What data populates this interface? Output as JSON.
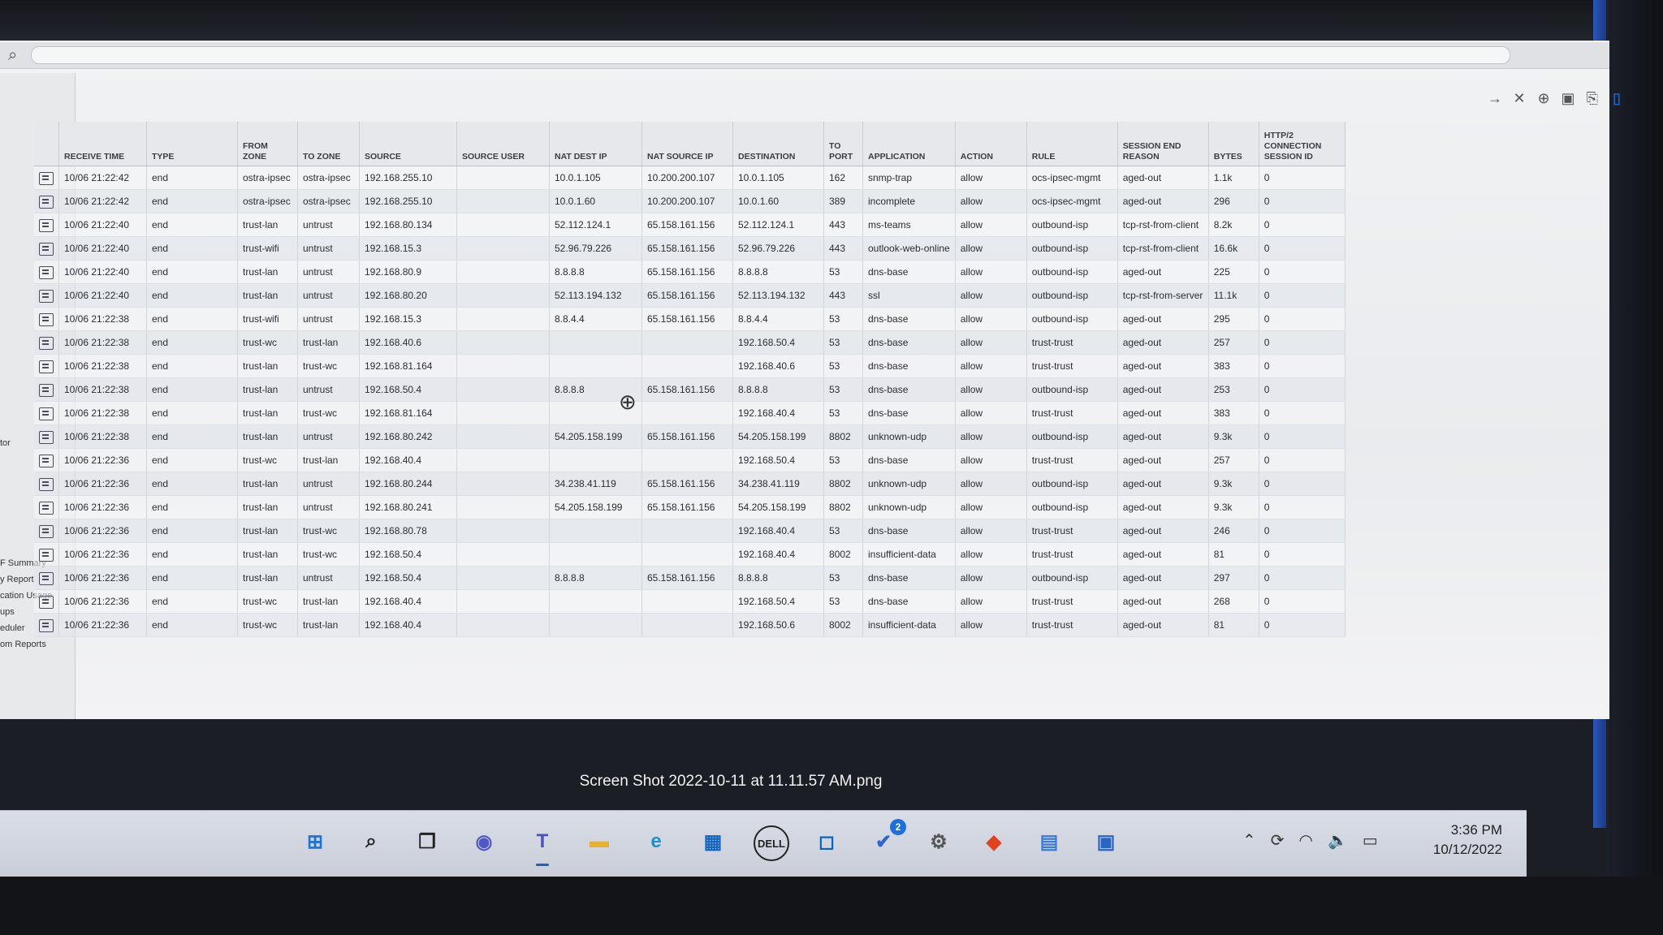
{
  "sidebar": {
    "items": [
      "tor",
      "F Summary",
      "y Report",
      "cation Usage",
      "ups",
      "eduler",
      "om Reports"
    ]
  },
  "table": {
    "columns": [
      "RECEIVE TIME",
      "TYPE",
      "FROM ZONE",
      "TO ZONE",
      "SOURCE",
      "SOURCE USER",
      "NAT DEST IP",
      "NAT SOURCE IP",
      "DESTINATION",
      "TO PORT",
      "APPLICATION",
      "ACTION",
      "RULE",
      "SESSION END REASON",
      "BYTES",
      "HTTP/2 CONNECTION SESSION ID"
    ],
    "rows": [
      [
        "10/06 21:22:42",
        "end",
        "ostra-ipsec",
        "ostra-ipsec",
        "192.168.255.10",
        "",
        "10.0.1.105",
        "10.200.200.107",
        "10.0.1.105",
        "162",
        "snmp-trap",
        "allow",
        "ocs-ipsec-mgmt",
        "aged-out",
        "1.1k",
        "0"
      ],
      [
        "10/06 21:22:42",
        "end",
        "ostra-ipsec",
        "ostra-ipsec",
        "192.168.255.10",
        "",
        "10.0.1.60",
        "10.200.200.107",
        "10.0.1.60",
        "389",
        "incomplete",
        "allow",
        "ocs-ipsec-mgmt",
        "aged-out",
        "296",
        "0"
      ],
      [
        "10/06 21:22:40",
        "end",
        "trust-lan",
        "untrust",
        "192.168.80.134",
        "",
        "52.112.124.1",
        "65.158.161.156",
        "52.112.124.1",
        "443",
        "ms-teams",
        "allow",
        "outbound-isp",
        "tcp-rst-from-client",
        "8.2k",
        "0"
      ],
      [
        "10/06 21:22:40",
        "end",
        "trust-wifi",
        "untrust",
        "192.168.15.3",
        "",
        "52.96.79.226",
        "65.158.161.156",
        "52.96.79.226",
        "443",
        "outlook-web-online",
        "allow",
        "outbound-isp",
        "tcp-rst-from-client",
        "16.6k",
        "0"
      ],
      [
        "10/06 21:22:40",
        "end",
        "trust-lan",
        "untrust",
        "192.168.80.9",
        "",
        "8.8.8.8",
        "65.158.161.156",
        "8.8.8.8",
        "53",
        "dns-base",
        "allow",
        "outbound-isp",
        "aged-out",
        "225",
        "0"
      ],
      [
        "10/06 21:22:40",
        "end",
        "trust-lan",
        "untrust",
        "192.168.80.20",
        "",
        "52.113.194.132",
        "65.158.161.156",
        "52.113.194.132",
        "443",
        "ssl",
        "allow",
        "outbound-isp",
        "tcp-rst-from-server",
        "11.1k",
        "0"
      ],
      [
        "10/06 21:22:38",
        "end",
        "trust-wifi",
        "untrust",
        "192.168.15.3",
        "",
        "8.8.4.4",
        "65.158.161.156",
        "8.8.4.4",
        "53",
        "dns-base",
        "allow",
        "outbound-isp",
        "aged-out",
        "295",
        "0"
      ],
      [
        "10/06 21:22:38",
        "end",
        "trust-wc",
        "trust-lan",
        "192.168.40.6",
        "",
        "",
        "",
        "192.168.50.4",
        "53",
        "dns-base",
        "allow",
        "trust-trust",
        "aged-out",
        "257",
        "0"
      ],
      [
        "10/06 21:22:38",
        "end",
        "trust-lan",
        "trust-wc",
        "192.168.81.164",
        "",
        "",
        "",
        "192.168.40.6",
        "53",
        "dns-base",
        "allow",
        "trust-trust",
        "aged-out",
        "383",
        "0"
      ],
      [
        "10/06 21:22:38",
        "end",
        "trust-lan",
        "untrust",
        "192.168.50.4",
        "",
        "8.8.8.8",
        "65.158.161.156",
        "8.8.8.8",
        "53",
        "dns-base",
        "allow",
        "outbound-isp",
        "aged-out",
        "253",
        "0"
      ],
      [
        "10/06 21:22:38",
        "end",
        "trust-lan",
        "trust-wc",
        "192.168.81.164",
        "",
        "",
        "",
        "192.168.40.4",
        "53",
        "dns-base",
        "allow",
        "trust-trust",
        "aged-out",
        "383",
        "0"
      ],
      [
        "10/06 21:22:38",
        "end",
        "trust-lan",
        "untrust",
        "192.168.80.242",
        "",
        "54.205.158.199",
        "65.158.161.156",
        "54.205.158.199",
        "8802",
        "unknown-udp",
        "allow",
        "outbound-isp",
        "aged-out",
        "9.3k",
        "0"
      ],
      [
        "10/06 21:22:36",
        "end",
        "trust-wc",
        "trust-lan",
        "192.168.40.4",
        "",
        "",
        "",
        "192.168.50.4",
        "53",
        "dns-base",
        "allow",
        "trust-trust",
        "aged-out",
        "257",
        "0"
      ],
      [
        "10/06 21:22:36",
        "end",
        "trust-lan",
        "untrust",
        "192.168.80.244",
        "",
        "34.238.41.119",
        "65.158.161.156",
        "34.238.41.119",
        "8802",
        "unknown-udp",
        "allow",
        "outbound-isp",
        "aged-out",
        "9.3k",
        "0"
      ],
      [
        "10/06 21:22:36",
        "end",
        "trust-lan",
        "untrust",
        "192.168.80.241",
        "",
        "54.205.158.199",
        "65.158.161.156",
        "54.205.158.199",
        "8802",
        "unknown-udp",
        "allow",
        "outbound-isp",
        "aged-out",
        "9.3k",
        "0"
      ],
      [
        "10/06 21:22:36",
        "end",
        "trust-lan",
        "trust-wc",
        "192.168.80.78",
        "",
        "",
        "",
        "192.168.40.4",
        "53",
        "dns-base",
        "allow",
        "trust-trust",
        "aged-out",
        "246",
        "0"
      ],
      [
        "10/06 21:22:36",
        "end",
        "trust-lan",
        "trust-wc",
        "192.168.50.4",
        "",
        "",
        "",
        "192.168.40.4",
        "8002",
        "insufficient-data",
        "allow",
        "trust-trust",
        "aged-out",
        "81",
        "0"
      ],
      [
        "10/06 21:22:36",
        "end",
        "trust-lan",
        "untrust",
        "192.168.50.4",
        "",
        "8.8.8.8",
        "65.158.161.156",
        "8.8.8.8",
        "53",
        "dns-base",
        "allow",
        "outbound-isp",
        "aged-out",
        "297",
        "0"
      ],
      [
        "10/06 21:22:36",
        "end",
        "trust-wc",
        "trust-lan",
        "192.168.40.4",
        "",
        "",
        "",
        "192.168.50.4",
        "53",
        "dns-base",
        "allow",
        "trust-trust",
        "aged-out",
        "268",
        "0"
      ],
      [
        "10/06 21:22:36",
        "end",
        "trust-wc",
        "trust-lan",
        "192.168.40.4",
        "",
        "",
        "",
        "192.168.50.6",
        "8002",
        "insufficient-data",
        "allow",
        "trust-trust",
        "aged-out",
        "81",
        "0"
      ]
    ]
  },
  "caption": "Screen Shot 2022-10-11 at 11.11.57 AM.png",
  "taskbar": {
    "apps": [
      {
        "name": "start-icon",
        "glyph": "⊞",
        "color": "#1c74d6"
      },
      {
        "name": "search-icon",
        "glyph": "⌕",
        "color": "#222"
      },
      {
        "name": "task-view-icon",
        "glyph": "❐",
        "color": "#222"
      },
      {
        "name": "chat-icon",
        "glyph": "◉",
        "color": "#5058c8"
      },
      {
        "name": "teams-icon",
        "glyph": "T",
        "color": "#4b53bc"
      },
      {
        "name": "file-explorer-icon",
        "glyph": "▬",
        "color": "#e8b22a"
      },
      {
        "name": "edge-icon",
        "glyph": "e",
        "color": "#1a8fd1"
      },
      {
        "name": "store-icon",
        "glyph": "▦",
        "color": "#1466c4"
      },
      {
        "name": "dell-icon",
        "glyph": "DELL",
        "color": "#222"
      },
      {
        "name": "app-square-icon",
        "glyph": "◻",
        "color": "#0a64c8"
      },
      {
        "name": "todo-icon",
        "glyph": "✔",
        "color": "#2a66d4"
      },
      {
        "name": "settings-icon",
        "glyph": "⚙",
        "color": "#555"
      },
      {
        "name": "brave-icon",
        "glyph": "◆",
        "color": "#e0411f"
      },
      {
        "name": "notepad-icon",
        "glyph": "▤",
        "color": "#3a7ad8"
      },
      {
        "name": "remote-desktop-icon",
        "glyph": "▣",
        "color": "#2a64c4"
      }
    ],
    "todo_badge": "2",
    "time": "3:36 PM",
    "date": "10/12/2022"
  }
}
